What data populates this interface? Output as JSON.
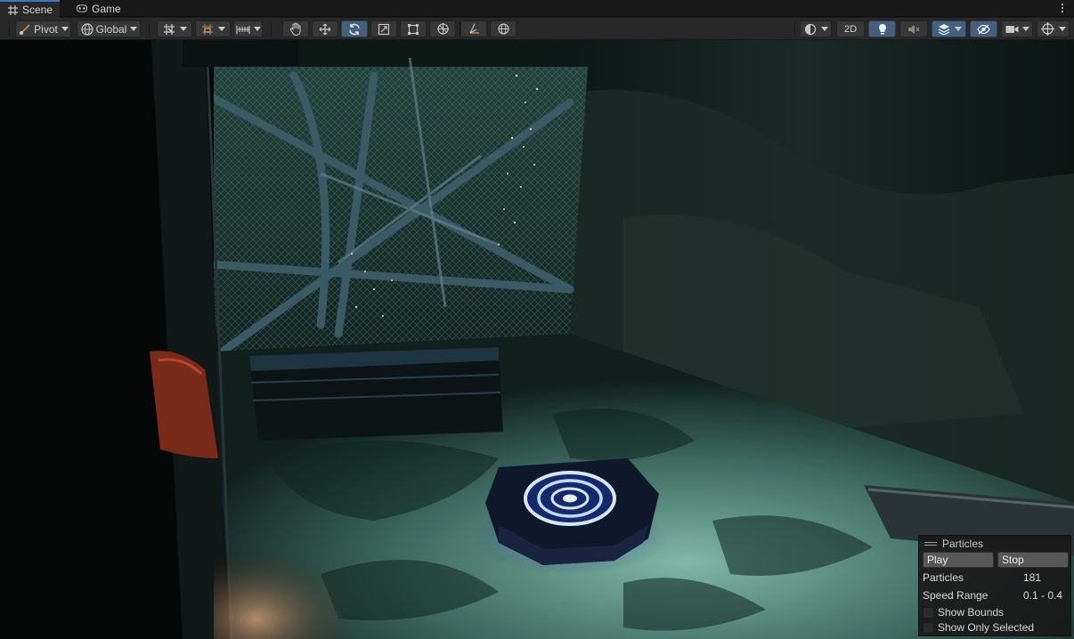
{
  "tabs": [
    {
      "label": "Scene",
      "icon": "grid-icon",
      "active": true
    },
    {
      "label": "Game",
      "icon": "gamepad-icon",
      "active": false
    }
  ],
  "toolbar": {
    "pivot_label": "Pivot",
    "global_label": "Global",
    "mode_2d_label": "2D"
  },
  "particles": {
    "title": "Particles",
    "play_label": "Play",
    "stop_label": "Stop",
    "count_label": "Particles",
    "count_value": "181",
    "speed_label": "Speed Range",
    "speed_value": "0.1 - 0.4",
    "show_bounds_label": "Show Bounds",
    "show_only_selected_label": "Show Only Selected"
  },
  "colors": {
    "accent_tab": "#3a79bb",
    "active_tool": "#46607c",
    "glow": "#8fb8ff"
  }
}
